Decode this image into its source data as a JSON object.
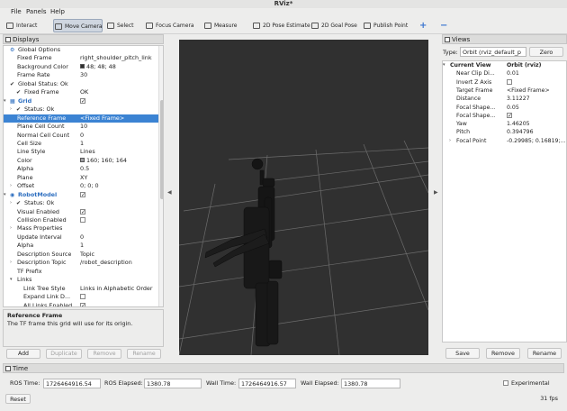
{
  "window": {
    "title": "RViz*"
  },
  "menu": [
    "File",
    "Panels",
    "Help"
  ],
  "toolbar": [
    {
      "label": "Interact",
      "icon": "interact-icon",
      "active": false
    },
    {
      "label": "Move Camera",
      "icon": "move-camera-icon",
      "active": true
    },
    {
      "label": "Select",
      "icon": "select-icon",
      "active": false
    },
    {
      "label": "Focus Camera",
      "icon": "focus-camera-icon",
      "active": false
    },
    {
      "label": "Measure",
      "icon": "measure-icon",
      "active": false
    },
    {
      "label": "2D Pose Estimate",
      "icon": "pose-estimate-icon",
      "active": false
    },
    {
      "label": "2D Goal Pose",
      "icon": "goal-pose-icon",
      "active": false
    },
    {
      "label": "Publish Point",
      "icon": "publish-point-icon",
      "active": false
    }
  ],
  "toolbar_extra": {
    "add": "+",
    "remove": "−"
  },
  "displays": {
    "title": "Displays",
    "rows": [
      {
        "key": "Global Options",
        "value": "",
        "indent": 1,
        "icon": "gear"
      },
      {
        "key": "Fixed Frame",
        "value": "right_shoulder_pitch_link",
        "indent": 2
      },
      {
        "key": "Background Color",
        "value": "48; 48; 48",
        "indent": 2,
        "swatch": "#303030"
      },
      {
        "key": "Frame Rate",
        "value": "30",
        "indent": 2
      },
      {
        "key": "Global Status: Ok",
        "value": "",
        "indent": 1,
        "icon": "check"
      },
      {
        "key": "Fixed Frame",
        "value": "OK",
        "indent": 2,
        "icon": "check"
      },
      {
        "key": "Grid",
        "value": "",
        "indent": 1,
        "icon": "grid",
        "blue": true,
        "checkbox": true,
        "expander": "▾"
      },
      {
        "key": "Status: Ok",
        "value": "",
        "indent": 2,
        "icon": "check",
        "expander": "›"
      },
      {
        "key": "Reference Frame",
        "value": "<Fixed Frame>",
        "indent": 2,
        "selected": true
      },
      {
        "key": "Plane Cell Count",
        "value": "10",
        "indent": 2
      },
      {
        "key": "Normal Cell Count",
        "value": "0",
        "indent": 2
      },
      {
        "key": "Cell Size",
        "value": "1",
        "indent": 2
      },
      {
        "key": "Line Style",
        "value": "Lines",
        "indent": 2
      },
      {
        "key": "Color",
        "value": "160; 160; 164",
        "indent": 2,
        "swatch": "#a0a0a4"
      },
      {
        "key": "Alpha",
        "value": "0.5",
        "indent": 2
      },
      {
        "key": "Plane",
        "value": "XY",
        "indent": 2
      },
      {
        "key": "Offset",
        "value": "0; 0; 0",
        "indent": 2,
        "expander": "›"
      },
      {
        "key": "RobotModel",
        "value": "",
        "indent": 1,
        "icon": "robot",
        "blue": true,
        "checkbox": true,
        "expander": "▾"
      },
      {
        "key": "Status: Ok",
        "value": "",
        "indent": 2,
        "icon": "check",
        "expander": "›"
      },
      {
        "key": "Visual Enabled",
        "value": "",
        "indent": 2,
        "checkbox": true
      },
      {
        "key": "Collision Enabled",
        "value": "",
        "indent": 2,
        "checkbox": false
      },
      {
        "key": "Mass Properties",
        "value": "",
        "indent": 2,
        "expander": "›"
      },
      {
        "key": "Update Interval",
        "value": "0",
        "indent": 2
      },
      {
        "key": "Alpha",
        "value": "1",
        "indent": 2
      },
      {
        "key": "Description Source",
        "value": "Topic",
        "indent": 2
      },
      {
        "key": "Description Topic",
        "value": "/robot_description",
        "indent": 2,
        "expander": "›"
      },
      {
        "key": "TF Prefix",
        "value": "",
        "indent": 2
      },
      {
        "key": "Links",
        "value": "",
        "indent": 2,
        "expander": "▾"
      },
      {
        "key": "Link Tree Style",
        "value": "Links in Alphabetic Order",
        "indent": 3
      },
      {
        "key": "Expand Link D...",
        "value": "",
        "indent": 3,
        "checkbox": false
      },
      {
        "key": "All Links Enabled",
        "value": "",
        "indent": 3,
        "checkbox": true
      }
    ],
    "description": {
      "title": "Reference Frame",
      "text": "The TF frame this grid will use for its origin."
    },
    "buttons": [
      {
        "label": "Add",
        "enabled": true
      },
      {
        "label": "Duplicate",
        "enabled": false
      },
      {
        "label": "Remove",
        "enabled": false
      },
      {
        "label": "Rename",
        "enabled": false
      }
    ]
  },
  "views": {
    "title": "Views",
    "type_label": "Type:",
    "type_value": "Orbit (rviz_default_p",
    "zero_label": "Zero",
    "rows": [
      {
        "key": "Current View",
        "value": "Orbit (rviz)",
        "indent": 1,
        "bold": true,
        "expander": "▾"
      },
      {
        "key": "Near Clip Di...",
        "value": "0.01",
        "indent": 2
      },
      {
        "key": "Invert Z Axis",
        "value": "",
        "indent": 2,
        "checkbox": false
      },
      {
        "key": "Target Frame",
        "value": "<Fixed Frame>",
        "indent": 2
      },
      {
        "key": "Distance",
        "value": "3.11227",
        "indent": 2
      },
      {
        "key": "Focal Shape...",
        "value": "0.05",
        "indent": 2
      },
      {
        "key": "Focal Shape...",
        "value": "",
        "indent": 2,
        "checkbox": true
      },
      {
        "key": "Yaw",
        "value": "1.46205",
        "indent": 2
      },
      {
        "key": "Pitch",
        "value": "0.394796",
        "indent": 2
      },
      {
        "key": "Focal Point",
        "value": "-0.29985; 0.16819;...",
        "indent": 2,
        "expander": "›"
      }
    ],
    "buttons": [
      "Save",
      "Remove",
      "Rename"
    ]
  },
  "time": {
    "title": "Time",
    "ros_time_label": "ROS Time:",
    "ros_time": "1726464916.54",
    "ros_elapsed_label": "ROS Elapsed:",
    "ros_elapsed": "1380.78",
    "wall_time_label": "Wall Time:",
    "wall_time": "1726464916.57",
    "wall_elapsed_label": "Wall Elapsed:",
    "wall_elapsed": "1380.78",
    "experimental_label": "Experimental",
    "reset_label": "Reset",
    "fps": "31 fps"
  }
}
